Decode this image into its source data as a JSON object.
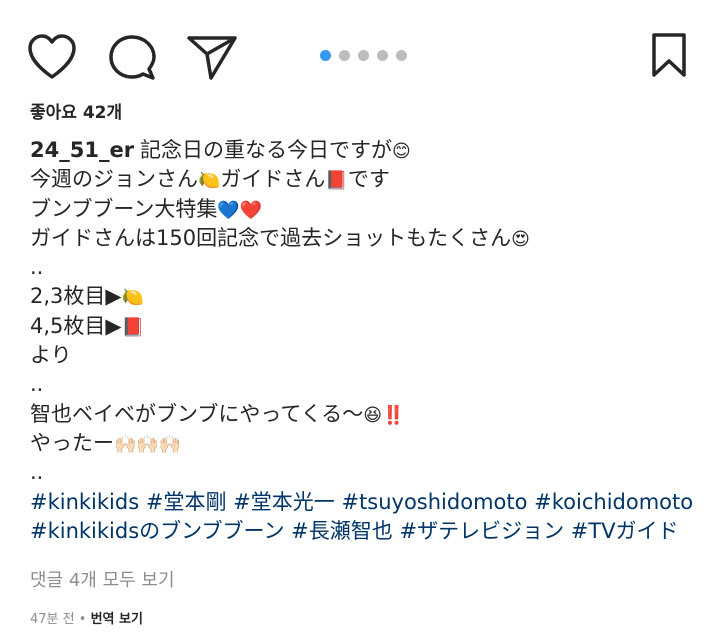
{
  "actions": {
    "heart_icon": "heart-outline",
    "comment_icon": "speech-bubble",
    "share_icon": "paper-plane",
    "bookmark_icon": "bookmark-outline"
  },
  "carousel": {
    "count": 5,
    "active_index": 0,
    "active_color": "#3897f0",
    "inactive_color": "#bcbcbc"
  },
  "likes": "좋아요 42개",
  "caption": {
    "username": "24_51_er",
    "lines": [
      {
        "text": "記念日の重なる今日ですが",
        "emoji": "😊"
      },
      {
        "text": "今週のジョンさん",
        "emoji": "🍋",
        "text2": "ガイドさん",
        "emoji2": "📕",
        "text3": "です"
      },
      {
        "text": "ブンブブーン大特集",
        "emoji": "💙❤️"
      },
      {
        "text": "ガイドさんは150回記念で過去ショットもたくさん",
        "emoji": "😍"
      },
      {
        "text": ".."
      },
      {
        "text": "2,3枚目▶",
        "emoji": "🍋"
      },
      {
        "text": "4,5枚目▶",
        "emoji": "📕"
      },
      {
        "text": "より"
      },
      {
        "text": ".."
      },
      {
        "text": "智也ベイベがブンブにやってくる〜",
        "emoji": "😆‼️"
      },
      {
        "text": "やったー",
        "emoji": "🙌🏻🙌🏻🙌🏻"
      },
      {
        "text": ".."
      }
    ],
    "hashtags_line1": [
      "#kinkikids",
      "#堂本剛",
      "#堂本光一",
      "#tsuyoshidomoto",
      "#koichidomoto"
    ],
    "hashtags_line2": [
      "#kinkikidsのブンブブーン",
      "#長瀬智也",
      "#ザテレビジョン",
      "#TVガイド"
    ]
  },
  "view_comments": "댓글 4개 모두 보기",
  "timestamp": "47분 전",
  "separator": "•",
  "translate": "번역 보기"
}
